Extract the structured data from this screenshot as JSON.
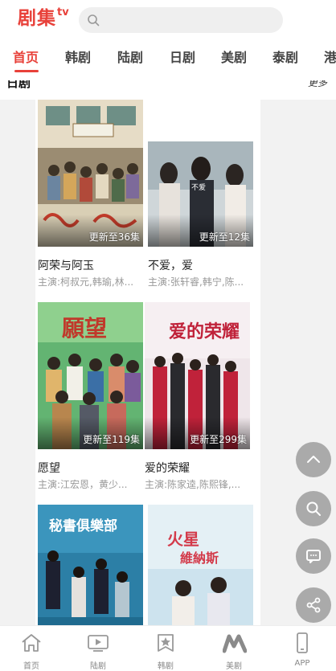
{
  "header": {
    "logo_text": "剧集",
    "logo_suffix": "tv",
    "search_placeholder": ""
  },
  "tabs": [
    {
      "label": "首页",
      "active": true
    },
    {
      "label": "韩剧"
    },
    {
      "label": "陆剧"
    },
    {
      "label": "日剧"
    },
    {
      "label": "美剧"
    },
    {
      "label": "泰剧"
    },
    {
      "label": "港"
    }
  ],
  "peek": {
    "left": "日剧",
    "right": "更多"
  },
  "cards": [
    {
      "title": "",
      "cast": "",
      "badge": ""
    },
    {
      "title": "",
      "cast": "",
      "badge": ""
    },
    {
      "title": "阿荣与阿玉",
      "cast": "主演:柯叔元,韩瑜,林...",
      "badge": "更新至36集"
    },
    {
      "title": "不爱，爱",
      "cast": "主演:张轩睿,韩宁,陈...",
      "badge": "更新至12集"
    },
    {
      "title": "愿望",
      "cast": "主演:江宏恩，黄少...",
      "badge": "更新至119集"
    },
    {
      "title": "爱的荣耀",
      "cast": "主演:陈家逵,陈熙锋,...",
      "badge": "更新至299集"
    },
    {
      "title": "",
      "cast": "",
      "badge": ""
    },
    {
      "title": "",
      "cast": "",
      "badge": ""
    }
  ],
  "bottom_nav": [
    {
      "label": "首页",
      "icon": "home-icon"
    },
    {
      "label": "陆剧",
      "icon": "tv-icon"
    },
    {
      "label": "韩剧",
      "icon": "star-icon"
    },
    {
      "label": "美剧",
      "icon": "m-logo-icon"
    },
    {
      "label": "APP",
      "icon": "phone-icon"
    }
  ],
  "colors": {
    "accent": "#e8413a",
    "fab": "#9e9e9e"
  }
}
